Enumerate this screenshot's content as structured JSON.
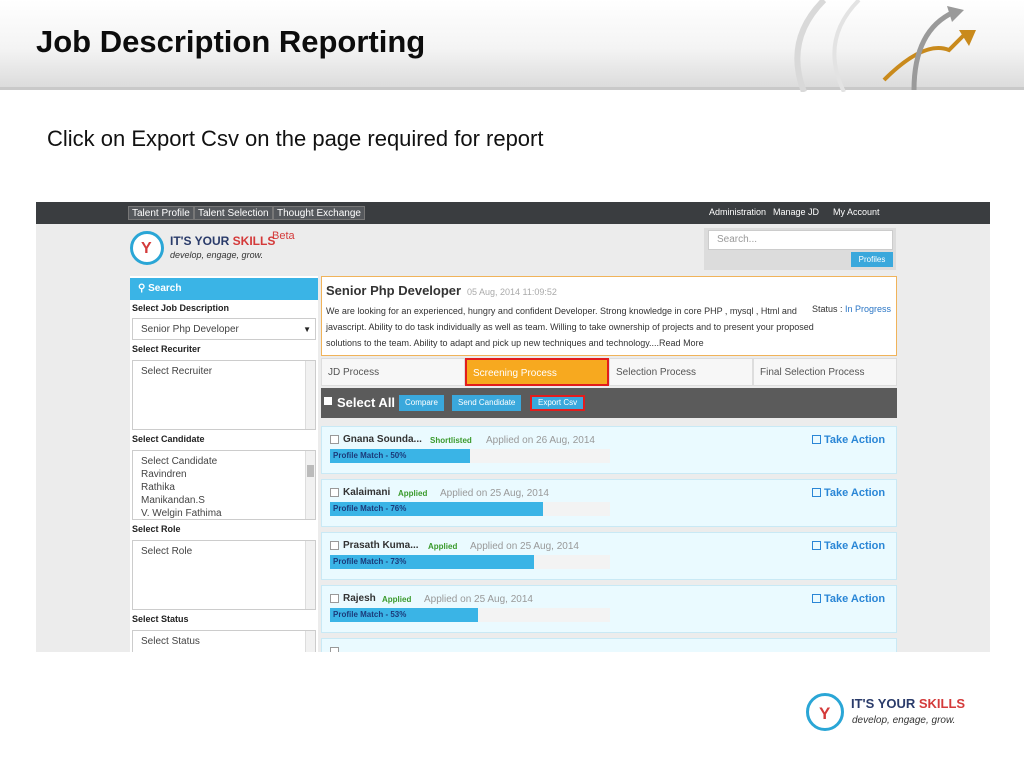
{
  "slide": {
    "title": "Job Description Reporting",
    "instruction": "Click on Export Csv on the page required for report"
  },
  "topnav": {
    "left": [
      "Talent Profile",
      "Talent Selection",
      "Thought Exchange"
    ],
    "right": [
      "Administration",
      "Manage JD",
      "My Account"
    ]
  },
  "header": {
    "logo_main": "IT'S YOUR ",
    "logo_accent": "SKILLS",
    "logo_beta": "Beta",
    "logo_tagline": "develop, engage, grow.",
    "search_placeholder": "Search...",
    "profiles_button": "Profiles"
  },
  "sidebar": {
    "search_label": "Search",
    "job_label": "Select Job Description",
    "job_selected": "Senior Php Developer",
    "recruiter_label": "Select Recuriter",
    "recruiter_options": [
      "Select Recruiter"
    ],
    "candidate_label": "Select Candidate",
    "candidate_options": [
      "Select Candidate",
      "Ravindren",
      "Rathika",
      "Manikandan.S",
      "V. Welgin Fathima"
    ],
    "role_label": "Select Role",
    "role_options": [
      "Select Role"
    ],
    "status_label": "Select Status",
    "status_options": [
      "Select Status"
    ]
  },
  "job": {
    "title": "Senior Php Developer",
    "date": "05 Aug, 2014 11:09:52",
    "description": "We are looking for an experienced, hungry and confident Developer. Strong knowledge in core PHP , mysql , Html and javascript. Ability to do task individually as well as team. Willing to take ownership of projects and to present your proposed solutions to the team. Ability to adapt and pick up new techniques and technology....Read More",
    "status_label": "Status : ",
    "status_value": "In Progress"
  },
  "tabs": [
    "JD Process",
    "Screening Process",
    "Selection Process",
    "Final Selection Process"
  ],
  "actions": {
    "select_all": "Select All",
    "compare": "Compare",
    "send_candidate": "Send Candidate",
    "export_csv": "Export Csv"
  },
  "candidates": [
    {
      "name": "Gnana Sounda...",
      "status": "Shortlisted",
      "applied": "Applied on 26 Aug, 2014",
      "match_label": "Profile Match - 50%",
      "match": 50,
      "action": "Take Action"
    },
    {
      "name": "Kalaimani",
      "status": "Applied",
      "applied": "Applied on 25 Aug, 2014",
      "match_label": "Profile Match - 76%",
      "match": 76,
      "action": "Take Action"
    },
    {
      "name": "Prasath Kuma...",
      "status": "Applied",
      "applied": "Applied on 25 Aug, 2014",
      "match_label": "Profile Match - 73%",
      "match": 73,
      "action": "Take Action"
    },
    {
      "name": "Rajesh",
      "status": "Applied",
      "applied": "Applied on 25 Aug, 2014",
      "match_label": "Profile Match - 53%",
      "match": 53,
      "action": "Take Action"
    }
  ],
  "footer": {
    "logo_main": "IT'S YOUR ",
    "logo_accent": "SKILLS",
    "logo_tagline": "develop, engage, grow."
  }
}
